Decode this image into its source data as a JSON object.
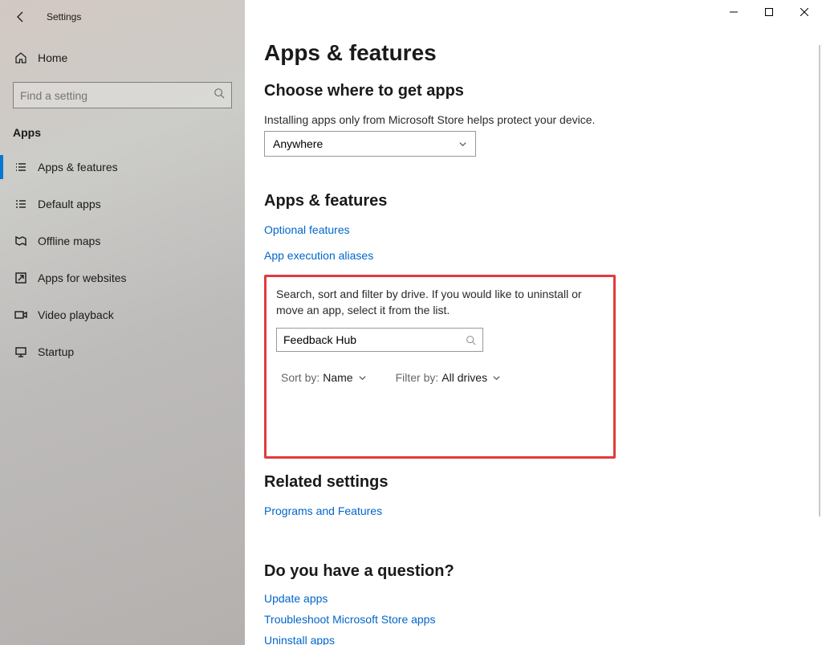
{
  "window": {
    "title": "Settings"
  },
  "sidebar": {
    "home": "Home",
    "search_placeholder": "Find a setting",
    "section": "Apps",
    "items": [
      {
        "label": "Apps & features"
      },
      {
        "label": "Default apps"
      },
      {
        "label": "Offline maps"
      },
      {
        "label": "Apps for websites"
      },
      {
        "label": "Video playback"
      },
      {
        "label": "Startup"
      }
    ]
  },
  "main": {
    "page_title": "Apps & features",
    "choose": {
      "heading": "Choose where to get apps",
      "desc": "Installing apps only from Microsoft Store helps protect your device.",
      "value": "Anywhere"
    },
    "appsfeat": {
      "heading": "Apps & features",
      "link_optional": "Optional features",
      "link_aliases": "App execution aliases",
      "filterbox": {
        "desc": "Search, sort and filter by drive. If you would like to uninstall or move an app, select it from the list.",
        "search_value": "Feedback Hub",
        "sort_label": "Sort by:",
        "sort_value": "Name",
        "filter_label": "Filter by:",
        "filter_value": "All drives"
      }
    },
    "related": {
      "heading": "Related settings",
      "link": "Programs and Features"
    },
    "question": {
      "heading": "Do you have a question?",
      "links": [
        "Update apps",
        "Troubleshoot Microsoft Store apps",
        "Uninstall apps"
      ]
    }
  }
}
